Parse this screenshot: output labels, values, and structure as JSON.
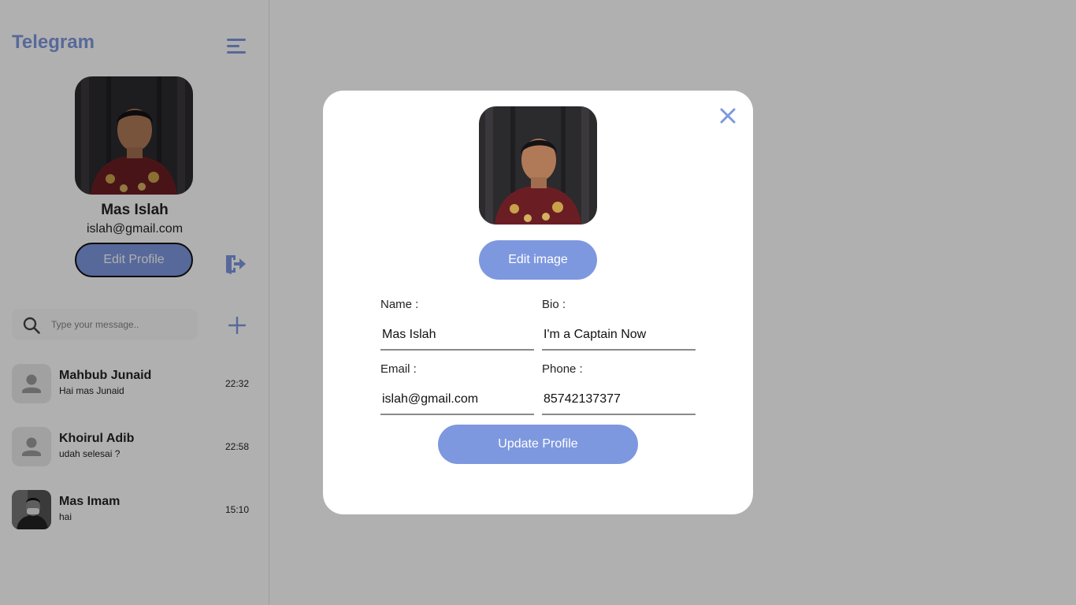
{
  "app": {
    "title": "Telegram",
    "accent_color": "#7E98DF"
  },
  "sidebar": {
    "menu_icon": "hamburger-menu-icon",
    "profile": {
      "name": "Mas Islah",
      "email": "islah@gmail.com",
      "edit_label": "Edit Profile"
    },
    "logout_icon": "logout-icon",
    "search": {
      "placeholder": "Type your message..",
      "icon": "search-icon"
    },
    "add_icon": "plus-icon",
    "chats": [
      {
        "name": "Mahbub Junaid",
        "last_message": "Hai mas Junaid",
        "time": "22:32",
        "avatar": "default-avatar"
      },
      {
        "name": "Khoirul Adib",
        "last_message": "udah selesai ?",
        "time": "22:58",
        "avatar": "default-avatar"
      },
      {
        "name": "Mas Imam",
        "last_message": "hai",
        "time": "15:10",
        "avatar": "photo"
      }
    ]
  },
  "modal": {
    "close_icon": "close-icon",
    "edit_image_label": "Edit image",
    "fields": {
      "name": {
        "label": "Name :",
        "value": "Mas Islah"
      },
      "bio": {
        "label": "Bio :",
        "value": "I'm a Captain Now"
      },
      "email": {
        "label": "Email :",
        "value": "islah@gmail.com"
      },
      "phone": {
        "label": "Phone :",
        "value": "85742137377"
      }
    },
    "update_label": "Update Profile"
  }
}
